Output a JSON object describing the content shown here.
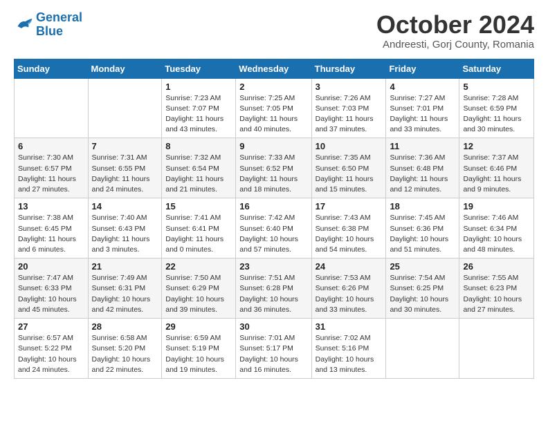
{
  "logo": {
    "line1": "General",
    "line2": "Blue"
  },
  "title": "October 2024",
  "subtitle": "Andreesti, Gorj County, Romania",
  "days_of_week": [
    "Sunday",
    "Monday",
    "Tuesday",
    "Wednesday",
    "Thursday",
    "Friday",
    "Saturday"
  ],
  "weeks": [
    [
      {
        "day": "",
        "info": ""
      },
      {
        "day": "",
        "info": ""
      },
      {
        "day": "1",
        "info": "Sunrise: 7:23 AM\nSunset: 7:07 PM\nDaylight: 11 hours and 43 minutes."
      },
      {
        "day": "2",
        "info": "Sunrise: 7:25 AM\nSunset: 7:05 PM\nDaylight: 11 hours and 40 minutes."
      },
      {
        "day": "3",
        "info": "Sunrise: 7:26 AM\nSunset: 7:03 PM\nDaylight: 11 hours and 37 minutes."
      },
      {
        "day": "4",
        "info": "Sunrise: 7:27 AM\nSunset: 7:01 PM\nDaylight: 11 hours and 33 minutes."
      },
      {
        "day": "5",
        "info": "Sunrise: 7:28 AM\nSunset: 6:59 PM\nDaylight: 11 hours and 30 minutes."
      }
    ],
    [
      {
        "day": "6",
        "info": "Sunrise: 7:30 AM\nSunset: 6:57 PM\nDaylight: 11 hours and 27 minutes."
      },
      {
        "day": "7",
        "info": "Sunrise: 7:31 AM\nSunset: 6:55 PM\nDaylight: 11 hours and 24 minutes."
      },
      {
        "day": "8",
        "info": "Sunrise: 7:32 AM\nSunset: 6:54 PM\nDaylight: 11 hours and 21 minutes."
      },
      {
        "day": "9",
        "info": "Sunrise: 7:33 AM\nSunset: 6:52 PM\nDaylight: 11 hours and 18 minutes."
      },
      {
        "day": "10",
        "info": "Sunrise: 7:35 AM\nSunset: 6:50 PM\nDaylight: 11 hours and 15 minutes."
      },
      {
        "day": "11",
        "info": "Sunrise: 7:36 AM\nSunset: 6:48 PM\nDaylight: 11 hours and 12 minutes."
      },
      {
        "day": "12",
        "info": "Sunrise: 7:37 AM\nSunset: 6:46 PM\nDaylight: 11 hours and 9 minutes."
      }
    ],
    [
      {
        "day": "13",
        "info": "Sunrise: 7:38 AM\nSunset: 6:45 PM\nDaylight: 11 hours and 6 minutes."
      },
      {
        "day": "14",
        "info": "Sunrise: 7:40 AM\nSunset: 6:43 PM\nDaylight: 11 hours and 3 minutes."
      },
      {
        "day": "15",
        "info": "Sunrise: 7:41 AM\nSunset: 6:41 PM\nDaylight: 11 hours and 0 minutes."
      },
      {
        "day": "16",
        "info": "Sunrise: 7:42 AM\nSunset: 6:40 PM\nDaylight: 10 hours and 57 minutes."
      },
      {
        "day": "17",
        "info": "Sunrise: 7:43 AM\nSunset: 6:38 PM\nDaylight: 10 hours and 54 minutes."
      },
      {
        "day": "18",
        "info": "Sunrise: 7:45 AM\nSunset: 6:36 PM\nDaylight: 10 hours and 51 minutes."
      },
      {
        "day": "19",
        "info": "Sunrise: 7:46 AM\nSunset: 6:34 PM\nDaylight: 10 hours and 48 minutes."
      }
    ],
    [
      {
        "day": "20",
        "info": "Sunrise: 7:47 AM\nSunset: 6:33 PM\nDaylight: 10 hours and 45 minutes."
      },
      {
        "day": "21",
        "info": "Sunrise: 7:49 AM\nSunset: 6:31 PM\nDaylight: 10 hours and 42 minutes."
      },
      {
        "day": "22",
        "info": "Sunrise: 7:50 AM\nSunset: 6:29 PM\nDaylight: 10 hours and 39 minutes."
      },
      {
        "day": "23",
        "info": "Sunrise: 7:51 AM\nSunset: 6:28 PM\nDaylight: 10 hours and 36 minutes."
      },
      {
        "day": "24",
        "info": "Sunrise: 7:53 AM\nSunset: 6:26 PM\nDaylight: 10 hours and 33 minutes."
      },
      {
        "day": "25",
        "info": "Sunrise: 7:54 AM\nSunset: 6:25 PM\nDaylight: 10 hours and 30 minutes."
      },
      {
        "day": "26",
        "info": "Sunrise: 7:55 AM\nSunset: 6:23 PM\nDaylight: 10 hours and 27 minutes."
      }
    ],
    [
      {
        "day": "27",
        "info": "Sunrise: 6:57 AM\nSunset: 5:22 PM\nDaylight: 10 hours and 24 minutes."
      },
      {
        "day": "28",
        "info": "Sunrise: 6:58 AM\nSunset: 5:20 PM\nDaylight: 10 hours and 22 minutes."
      },
      {
        "day": "29",
        "info": "Sunrise: 6:59 AM\nSunset: 5:19 PM\nDaylight: 10 hours and 19 minutes."
      },
      {
        "day": "30",
        "info": "Sunrise: 7:01 AM\nSunset: 5:17 PM\nDaylight: 10 hours and 16 minutes."
      },
      {
        "day": "31",
        "info": "Sunrise: 7:02 AM\nSunset: 5:16 PM\nDaylight: 10 hours and 13 minutes."
      },
      {
        "day": "",
        "info": ""
      },
      {
        "day": "",
        "info": ""
      }
    ]
  ]
}
